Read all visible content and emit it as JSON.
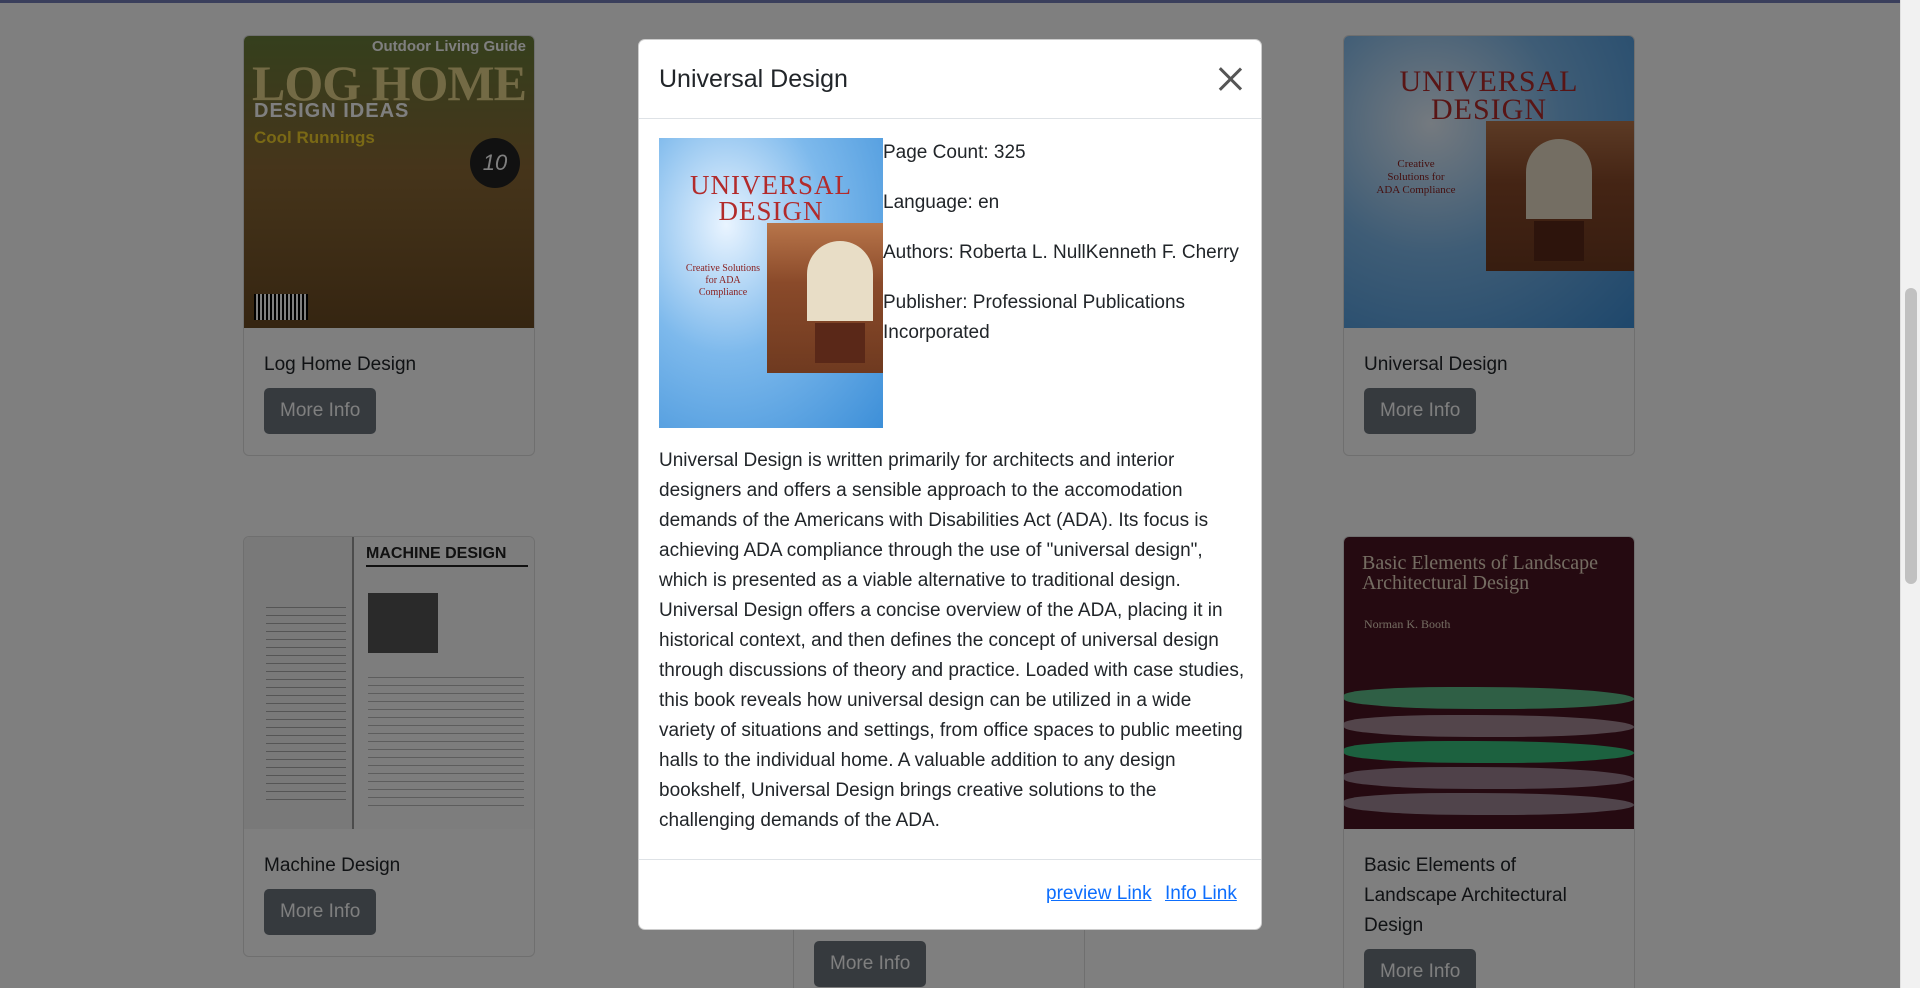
{
  "cards": [
    {
      "title": "Log Home Design",
      "button": "More Info",
      "cover": {
        "masthead": "LOG HOME",
        "subhead": "DESIGN IDEAS",
        "tagline": "Outdoor Living Guide",
        "feature": "Cool Runnings",
        "badge": "10"
      }
    },
    {
      "title": "Universal Design",
      "button": "More Info",
      "cover": {
        "title": "UNIVERSAL DESIGN",
        "blurb": "Creative Solutions for ADA Compliance"
      }
    },
    {
      "title": "Machine Design",
      "button": "More Info",
      "cover": {
        "masthead": "MACHINE DESIGN"
      }
    },
    {
      "title": "Basic Elements of Landscape Architectural Design",
      "button": "More Info",
      "cover": {
        "title": "Basic Elements of Landscape Architectural Design",
        "author": "Norman K. Booth"
      }
    },
    {
      "title": "",
      "button": "More Info"
    }
  ],
  "modal": {
    "title": "Universal Design",
    "page_count": "Page Count: 325",
    "language": "Language: en",
    "authors": "Authors: Roberta L. NullKenneth F. Cherry",
    "publisher": "Publisher: Professional Publications Incorporated",
    "cover": {
      "title": "UNIVERSAL DESIGN",
      "blurb": "Creative Solutions for ADA Compliance"
    },
    "description": "Universal Design is written primarily for architects and interior designers and offers a sensible approach to the accomodation demands of the Americans with Disabilities Act (ADA). Its focus is achieving ADA compliance through the use of \"universal design\", which is presented as a viable alternative to traditional design. Universal Design offers a concise overview of the ADA, placing it in historical context, and then defines the concept of universal design through discussions of theory and practice. Loaded with case studies, this book reveals how universal design can be utilized in a wide variety of situations and settings, from office spaces to public meeting halls to the individual home. A valuable addition to any design bookshelf, Universal Design brings creative solutions to the challenging demands of the ADA.",
    "preview_link": "preview Link",
    "info_link": "Info Link",
    "close_icon": "close-icon"
  },
  "colors": {
    "button_bg": "#6c757d",
    "link": "#0d6efd",
    "backdrop": "rgba(0,0,0,0.5)"
  }
}
